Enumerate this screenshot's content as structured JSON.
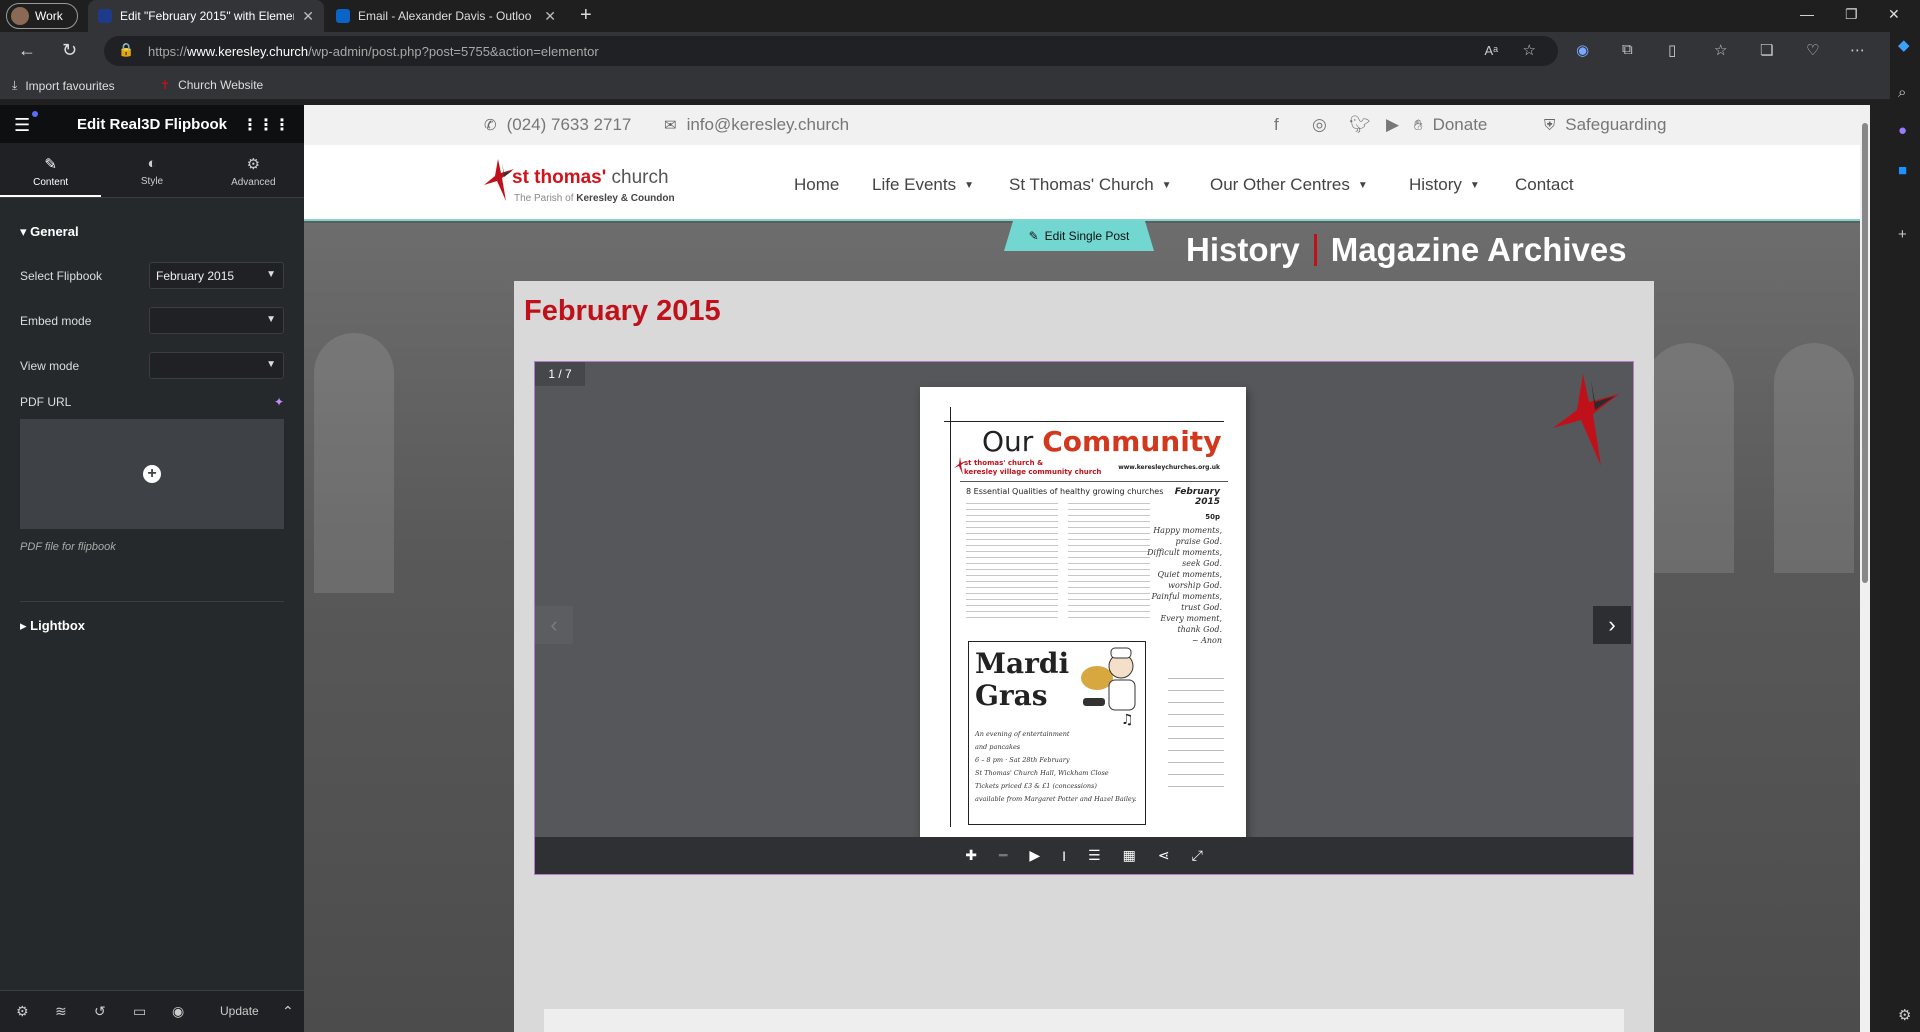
{
  "browser": {
    "profile_label": "Work",
    "tabs": [
      {
        "title": "Edit \"February 2015\" with Elemen",
        "active": true
      },
      {
        "title": "Email - Alexander Davis - Outloo",
        "active": false
      }
    ],
    "url_scheme": "https://",
    "url_host": "www.keresley.church",
    "url_path": "/wp-admin/post.php?post=5755&action=elementor",
    "bookmarks": [
      "Import favourites",
      "Church Website"
    ]
  },
  "panel": {
    "title": "Edit Real3D Flipbook",
    "tabs": [
      "Content",
      "Style",
      "Advanced"
    ],
    "general_title": "General",
    "select_flipbook_label": "Select Flipbook",
    "select_flipbook_value": "February 2015",
    "embed_mode_label": "Embed mode",
    "embed_mode_value": "",
    "view_mode_label": "View mode",
    "view_mode_value": "",
    "pdf_url_label": "PDF URL",
    "pdf_hint": "PDF file for flipbook",
    "lightbox_title": "Lightbox",
    "update_label": "Update"
  },
  "site": {
    "phone": "(024) 7633 2717",
    "email": "info@keresley.church",
    "donate": "Donate",
    "safeguarding": "Safeguarding",
    "logo_name": "st thomas'",
    "logo_church": "church",
    "logo_parish_prefix": "The Parish of",
    "logo_parish": "Keresley & Coundon",
    "nav": [
      {
        "label": "Home",
        "dropdown": false
      },
      {
        "label": "Life Events",
        "dropdown": true
      },
      {
        "label": "St Thomas' Church",
        "dropdown": true
      },
      {
        "label": "Our Other Centres",
        "dropdown": true
      },
      {
        "label": "History",
        "dropdown": true
      },
      {
        "label": "Contact",
        "dropdown": false
      }
    ],
    "edit_single_post": "Edit Single Post",
    "heading_left": "History",
    "heading_right": "Magazine Archives",
    "post_title": "February 2015",
    "flipbook_page_counter": "1 / 7"
  },
  "magazine": {
    "title_a": "Our",
    "title_b": "Community",
    "brand_line1": "st thomas' church &",
    "brand_line2": "keresley village community church",
    "website": "www.keresleychurches.org.uk",
    "subtitle": "8 Essential Qualities of healthy growing churches",
    "date": "February 2015",
    "price": "50p",
    "poem": [
      "Happy moments,",
      "praise God.",
      "Difficult moments,",
      "seek God.",
      "Quiet moments,",
      "worship God.",
      "Painful moments,",
      "trust God.",
      "Every moment,",
      "thank God.",
      "~ Anon"
    ],
    "mardi_title": "Mardi Gras",
    "event_lines": [
      "An evening of entertainment",
      "and pancakes",
      "6 – 8 pm  ·  Sat 28th February",
      "St Thomas' Church Hall, Wickham Close",
      "Tickets priced £3 & £1 (concessions)",
      "available from Margaret Potter and Hazel Bailey."
    ]
  },
  "colors": {
    "accent_red": "#c0111a",
    "teal": "#71d7d0",
    "panel_bg": "#26292c",
    "viewer_border": "#b47cc8"
  }
}
